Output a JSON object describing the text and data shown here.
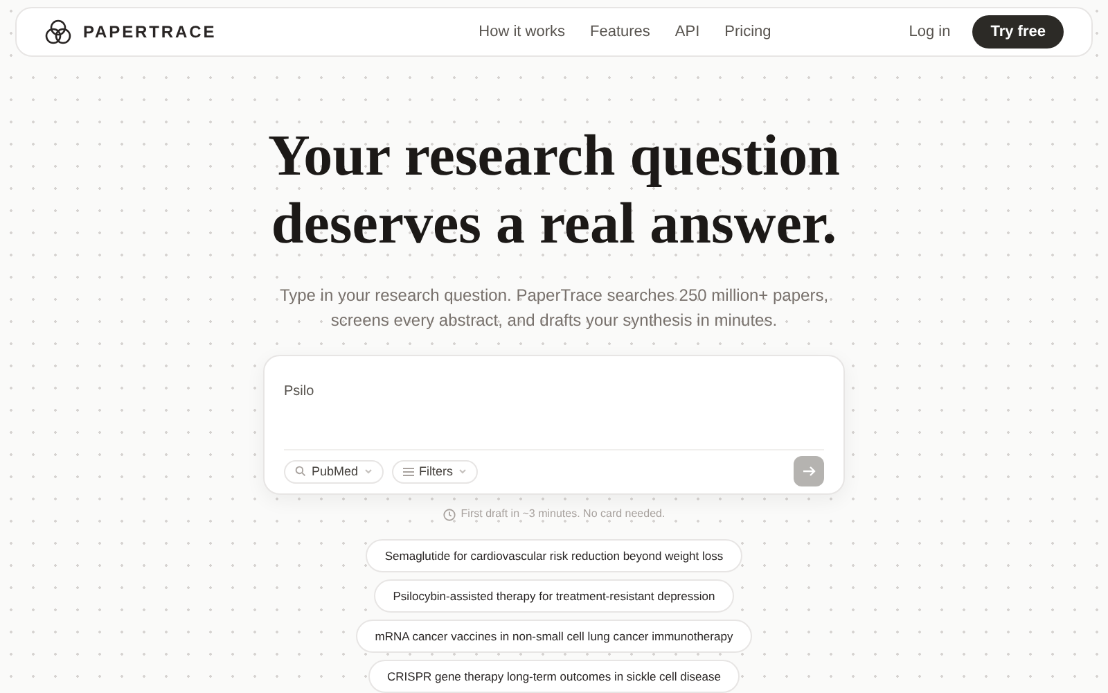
{
  "brand": "PAPERTRACE",
  "nav": [
    {
      "label": "How it works"
    },
    {
      "label": "Features"
    },
    {
      "label": "API"
    },
    {
      "label": "Pricing"
    }
  ],
  "login": "Log in",
  "cta": "Try free",
  "headline": [
    "Your research question",
    "deserves a real answer."
  ],
  "subtitle": [
    "Type in your research question. PaperTrace searches 250 million+ papers,",
    "screens every abstract, and drafts your synthesis in minutes."
  ],
  "query": {
    "value": "Psilo",
    "source": "PubMed",
    "filters": "Filters",
    "submit_disabled": true
  },
  "note": "First draft in ~3 minutes. No card needed.",
  "suggestions": [
    "Semaglutide for cardiovascular risk reduction beyond weight loss",
    "Psilocybin-assisted therapy for treatment-resistant depression",
    "mRNA cancer vaccines in non-small cell lung cancer immunotherapy",
    "CRISPR gene therapy long-term outcomes in sickle cell disease"
  ]
}
